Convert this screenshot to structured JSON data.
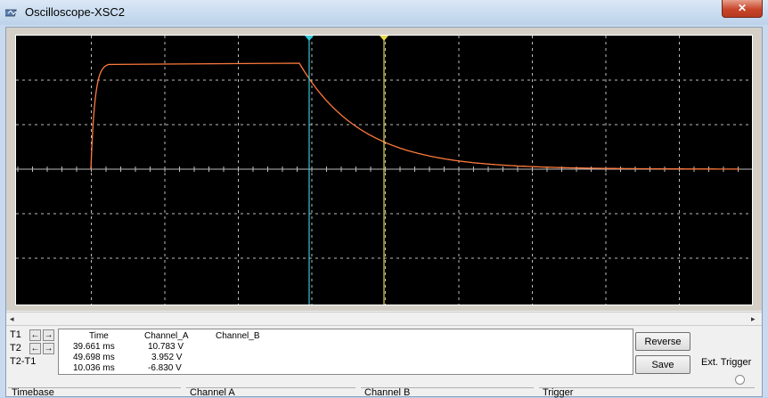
{
  "window": {
    "title": "Oscilloscope-XSC2",
    "close_glyph": "✕",
    "icon": "oscilloscope-app-icon"
  },
  "colors": {
    "trace": "#ff7a3d",
    "cursor1": "#33c9d9",
    "cursor2": "#e8d94a",
    "grid": "#bdbdbd",
    "screen_bg": "#000000"
  },
  "readout": {
    "headers": {
      "time": "Time",
      "channel_a": "Channel_A",
      "channel_b": "Channel_B"
    },
    "rows": [
      {
        "label": "T1",
        "time": "39.661 ms",
        "channel_a": "10.783 V",
        "channel_b": ""
      },
      {
        "label": "T2",
        "time": "49.698 ms",
        "channel_a": "3.952 V",
        "channel_b": ""
      },
      {
        "label": "T2-T1",
        "time": "10.036 ms",
        "channel_a": "-6.830 V",
        "channel_b": ""
      }
    ]
  },
  "buttons": {
    "reverse": "Reverse",
    "save": "Save"
  },
  "ext_trigger": "Ext. Trigger",
  "groups": {
    "timebase": "Timebase",
    "channel_a": "Channel A",
    "channel_b": "Channel B",
    "trigger": "Trigger"
  },
  "scroll": {
    "left_glyph": "◂",
    "right_glyph": "▸"
  }
}
